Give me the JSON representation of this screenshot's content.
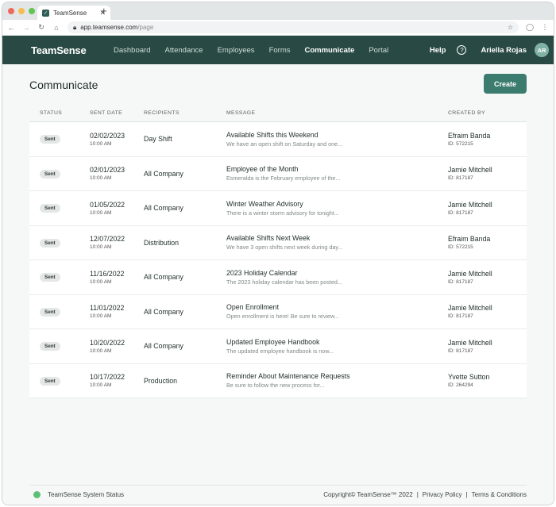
{
  "browser": {
    "tab_title": "TeamSense",
    "tab_close": "✕",
    "new_tab": "+",
    "url_host": "app.teamsense.com",
    "url_path": "/page",
    "traffic_colors": [
      "#ee6a5f",
      "#f5bd4f",
      "#61c454"
    ]
  },
  "app": {
    "logo": "TeamSense",
    "nav": [
      "Dashboard",
      "Attendance",
      "Employees",
      "Forms",
      "Communicate",
      "Portal"
    ],
    "active_nav": "Communicate",
    "help": "Help",
    "user_name": "Ariella Rojas",
    "avatar_initials": "AR",
    "brand_color": "#294a44",
    "accent_color": "#3c7c6f"
  },
  "page": {
    "title": "Communicate",
    "create_label": "Create"
  },
  "table": {
    "headers": [
      "STATUS",
      "SENT DATE",
      "RECIPIENTS",
      "MESSAGE",
      "CREATED BY"
    ],
    "rows": [
      {
        "status": "Sent",
        "date": "02/02/2023",
        "time": "10:00 AM",
        "recipients": "Day Shift",
        "title": "Available Shifts this Weekend",
        "preview": "We have an open shift on Saturday and one...",
        "creator": "Efraim Banda",
        "creator_id": "ID: 572215"
      },
      {
        "status": "Sent",
        "date": "02/01/2023",
        "time": "10:00 AM",
        "recipients": "All Company",
        "title": "Employee of the Month",
        "preview": "Esmeralda is the February employee of the...",
        "creator": "Jamie Mitchell",
        "creator_id": "ID: 817187"
      },
      {
        "status": "Sent",
        "date": "01/05/2022",
        "time": "10:00 AM",
        "recipients": "All Company",
        "title": "Winter Weather Advisory",
        "preview": "There is a winter storm advisory for tonight...",
        "creator": "Jamie Mitchell",
        "creator_id": "ID: 817187"
      },
      {
        "status": "Sent",
        "date": "12/07/2022",
        "time": "10:00 AM",
        "recipients": "Distribution",
        "title": "Available Shifts Next Week",
        "preview": "We have 3 open shifts next week during day...",
        "creator": "Efraim Banda",
        "creator_id": "ID: 572215"
      },
      {
        "status": "Sent",
        "date": "11/16/2022",
        "time": "10:00 AM",
        "recipients": "All Company",
        "title": "2023 Holiday Calendar",
        "preview": "The 2023 holiday calendar has been posted...",
        "creator": "Jamie Mitchell",
        "creator_id": "ID: 817187"
      },
      {
        "status": "Sent",
        "date": "11/01/2022",
        "time": "10:00 AM",
        "recipients": "All Company",
        "title": "Open Enrollment",
        "preview": "Open enrollment is here! Be sure to review...",
        "creator": "Jamie Mitchell",
        "creator_id": "ID: 817187"
      },
      {
        "status": "Sent",
        "date": "10/20/2022",
        "time": "10:00 AM",
        "recipients": "All Company",
        "title": "Updated Employee Handbook",
        "preview": "The updated employee handbook is now...",
        "creator": "Jamie Mitchell",
        "creator_id": "ID: 817187"
      },
      {
        "status": "Sent",
        "date": "10/17/2022",
        "time": "10:00 AM",
        "recipients": "Production",
        "title": "Reminder About Maintenance Requests",
        "preview": "Be sure to follow the new process for...",
        "creator": "Yvette Sutton",
        "creator_id": "ID: 264294"
      }
    ]
  },
  "footer": {
    "status_label": "TeamSense System Status",
    "status_color": "#5cbf77",
    "copyright": "Copyright© TeamSense™ 2022",
    "privacy": "Privacy Policy",
    "terms": "Terms & Conditions",
    "separator": "|"
  }
}
